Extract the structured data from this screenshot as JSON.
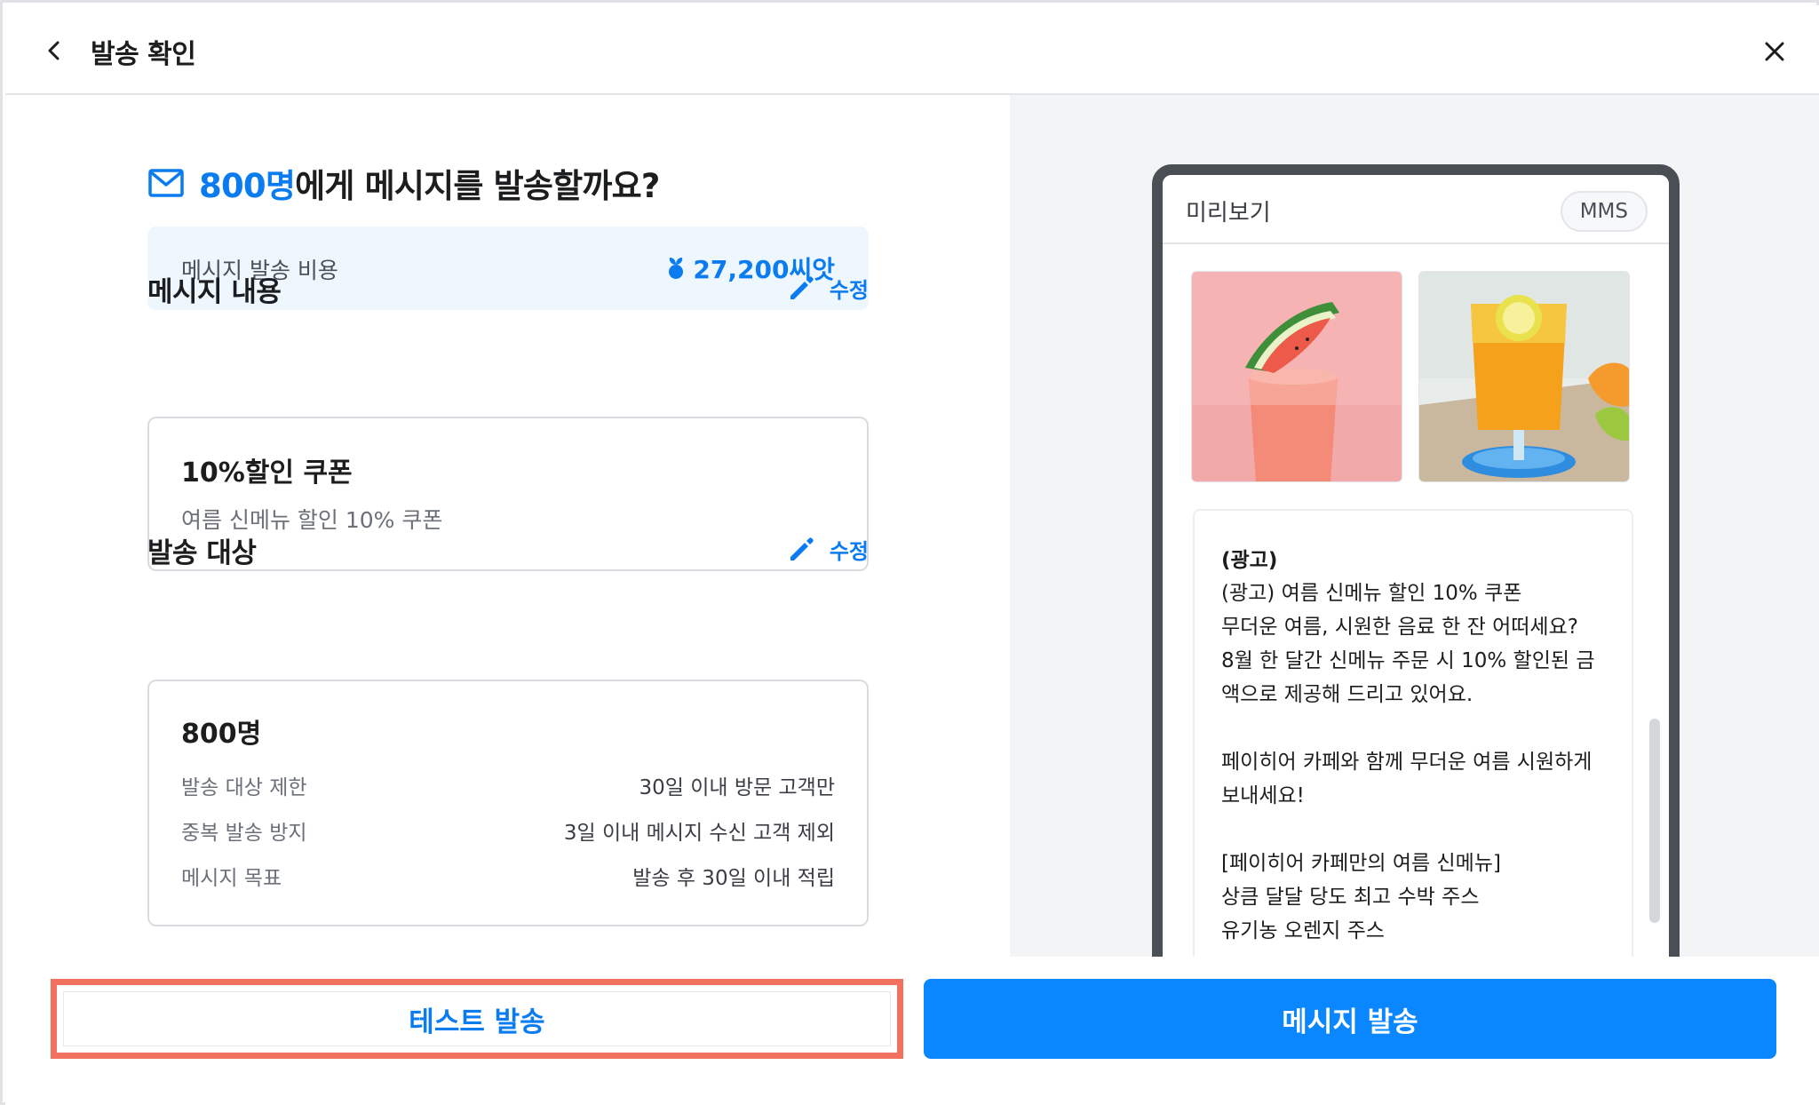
{
  "header": {
    "title": "발송 확인",
    "back_icon": "chevron-left-icon",
    "close_icon": "close-icon"
  },
  "summary": {
    "recipient_count": "800명",
    "question": "에게 메시지를 발송할까요?",
    "mail_icon": "mail-icon"
  },
  "cost": {
    "label": "메시지 발송 비용",
    "value": "27,200씨앗",
    "icon": "seed-icon"
  },
  "content_section": {
    "title": "메시지 내용",
    "edit_label": "수정",
    "card_title": "10%할인 쿠폰",
    "card_subtitle": "여름 신메뉴 할인 10% 쿠폰"
  },
  "target_section": {
    "title": "발송 대상",
    "edit_label": "수정",
    "count": "800명",
    "rows": [
      {
        "label": "발송 대상 제한",
        "value": "30일 이내 방문 고객만"
      },
      {
        "label": "중복 발송 방지",
        "value": "3일 이내 메시지 수신 고객 제외"
      },
      {
        "label": "메시지 목표",
        "value": "발송 후 30일 이내 적립"
      }
    ]
  },
  "preview": {
    "title": "미리보기",
    "badge": "MMS",
    "message_header": "(광고)",
    "message_lines": [
      "(광고) 여름 신메뉴 할인 10% 쿠폰",
      "무더운 여름, 시원한 음료 한 잔 어떠세요?",
      "8월 한 달간 신메뉴 주문 시 10% 할인된 금",
      "액으로 제공해 드리고 있어요.",
      "",
      "페이히어 카페와 함께 무더운 여름 시원하게",
      "보내세요!",
      "",
      "[페이히어 카페만의 여름 신메뉴]",
      "상큼 달달 당도 최고 수박 주스",
      "유기농 오렌지 주스"
    ]
  },
  "footer": {
    "test_send_label": "테스트 발송",
    "send_label": "메시지 발송"
  },
  "colors": {
    "accent": "#0a7cf0",
    "primary_button": "#0a86ff",
    "highlight_border": "#f2705e"
  }
}
